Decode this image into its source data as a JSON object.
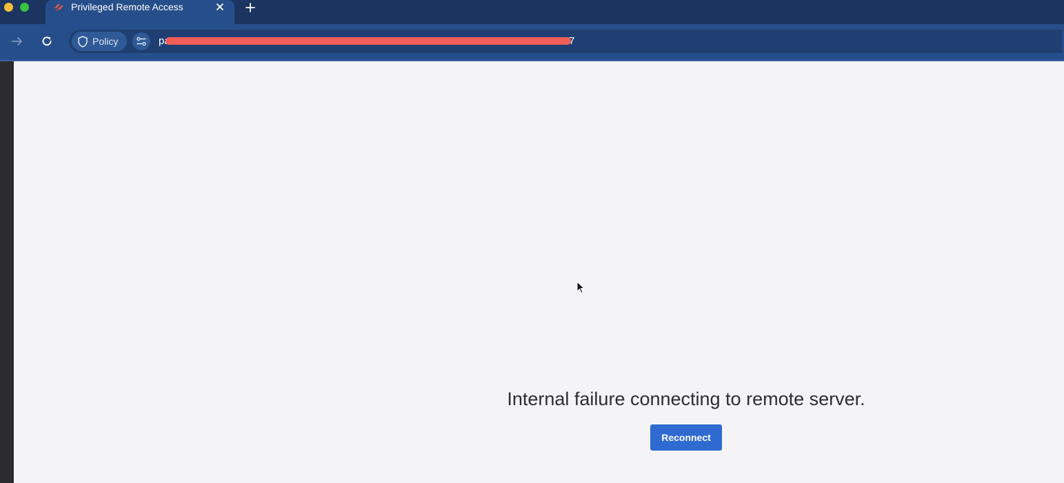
{
  "browser": {
    "tab": {
      "title": "Privileged Remote Access",
      "favicon": "prisma-logo-icon"
    },
    "toolbar": {
      "policy_label": "Policy",
      "url_visible_prefix": "pa",
      "url_visible_suffix": "7"
    },
    "colors": {
      "tabbar_bg": "#1b3460",
      "toolbar_bg": "#264e8a",
      "redaction": "#f25d59"
    }
  },
  "page": {
    "error_message": "Internal failure connecting to remote server.",
    "reconnect_label": "Reconnect",
    "colors": {
      "background": "#f4f4f6",
      "button": "#2f6ad0"
    }
  },
  "icons": [
    "forward-icon",
    "reload-icon",
    "shield-icon",
    "site-settings-icon",
    "close-icon",
    "plus-icon",
    "mouse-cursor-icon"
  ]
}
